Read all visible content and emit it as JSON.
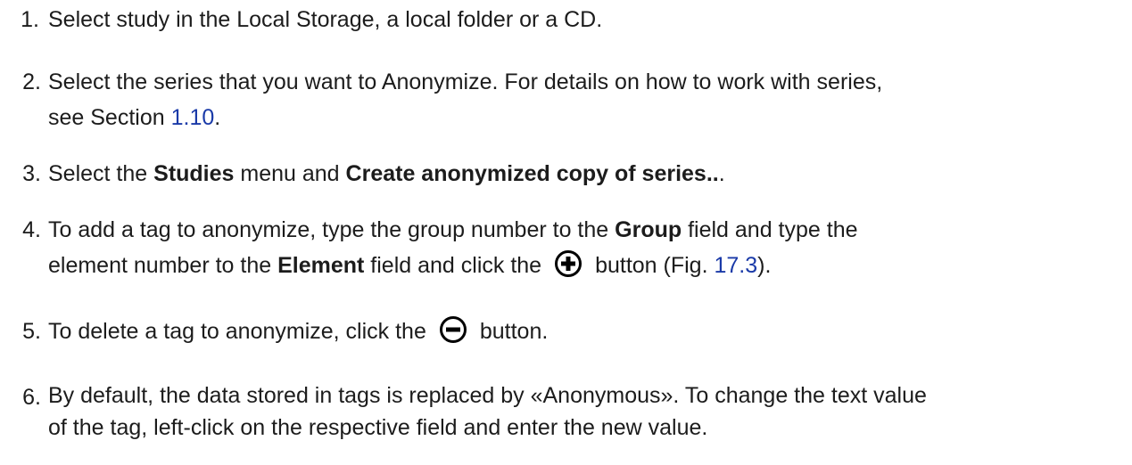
{
  "steps": [
    {
      "num": "1.",
      "text": "Select study in the Local Storage, a local folder or a CD."
    },
    {
      "num": "2.",
      "text_a": "Select the series that you want to Anonymize.  For details on how to work with series,",
      "text_b": "see Section ",
      "link": "1.10",
      "text_c": "."
    },
    {
      "num": "3.",
      "text_a": "Select the ",
      "bold_1": "Studies",
      "text_b": " menu and ",
      "bold_2": "Create anonymized copy of series..",
      "text_c": "."
    },
    {
      "num": "4.",
      "text_a": "To add a tag to anonymize, type the group number to the ",
      "bold_1": "Group",
      "text_b": " field and type the",
      "text_c": "element number to the ",
      "bold_2": "Element",
      "text_d": " field and click the",
      "text_e": "button (Fig. ",
      "link": "17.3",
      "text_f": ").",
      "icon": "plus-circle-icon"
    },
    {
      "num": "5.",
      "text_a": "To delete a tag to anonymize, click the",
      "text_b": "button.",
      "icon": "minus-circle-icon"
    },
    {
      "num": "6.",
      "text_a": "By default, the data stored in tags is replaced by «Anonymous».  To change the text value",
      "text_b": "of the tag, left-click on the respective field and enter the new value."
    }
  ],
  "colors": {
    "text": "#1c1c1c",
    "link": "#1a3aa8"
  }
}
